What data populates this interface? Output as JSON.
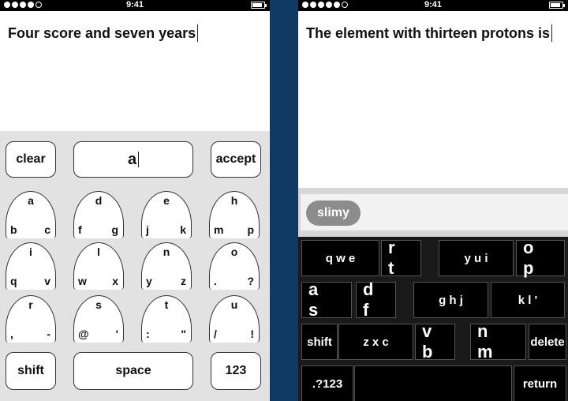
{
  "status_bar": {
    "time": "9:41"
  },
  "left_phone": {
    "text": "Four score and seven years",
    "controls": {
      "clear": "clear",
      "entry": "a",
      "accept": "accept"
    },
    "keys": [
      {
        "top": "a",
        "bl": "b",
        "br": "c"
      },
      {
        "top": "d",
        "bl": "f",
        "br": "g"
      },
      {
        "top": "e",
        "bl": "j",
        "br": "k"
      },
      {
        "top": "h",
        "bl": "m",
        "br": "p"
      },
      {
        "top": "i",
        "bl": "q",
        "br": "v"
      },
      {
        "top": "l",
        "bl": "w",
        "br": "x"
      },
      {
        "top": "n",
        "bl": "y",
        "br": "z"
      },
      {
        "top": "o",
        "bl": ".",
        "br": "?"
      },
      {
        "top": "r",
        "bl": ",",
        "br": "-"
      },
      {
        "top": "s",
        "bl": "@",
        "br": "'"
      },
      {
        "top": "t",
        "bl": ":",
        "br": "\""
      },
      {
        "top": "u",
        "bl": "/",
        "br": "!"
      }
    ],
    "bottom": {
      "shift": "shift",
      "space": "space",
      "numbers": "123"
    }
  },
  "right_phone": {
    "text": "The element with thirteen protons is",
    "suggestion": "slimy",
    "rows": [
      [
        "q w e",
        "r t",
        "y u i",
        "o p"
      ],
      [
        "a s",
        "d f",
        "g h j",
        "k l '"
      ],
      [
        "shift",
        "z x c",
        "v b",
        "n m",
        "delete"
      ],
      [
        ".?123",
        "",
        "return"
      ]
    ]
  }
}
